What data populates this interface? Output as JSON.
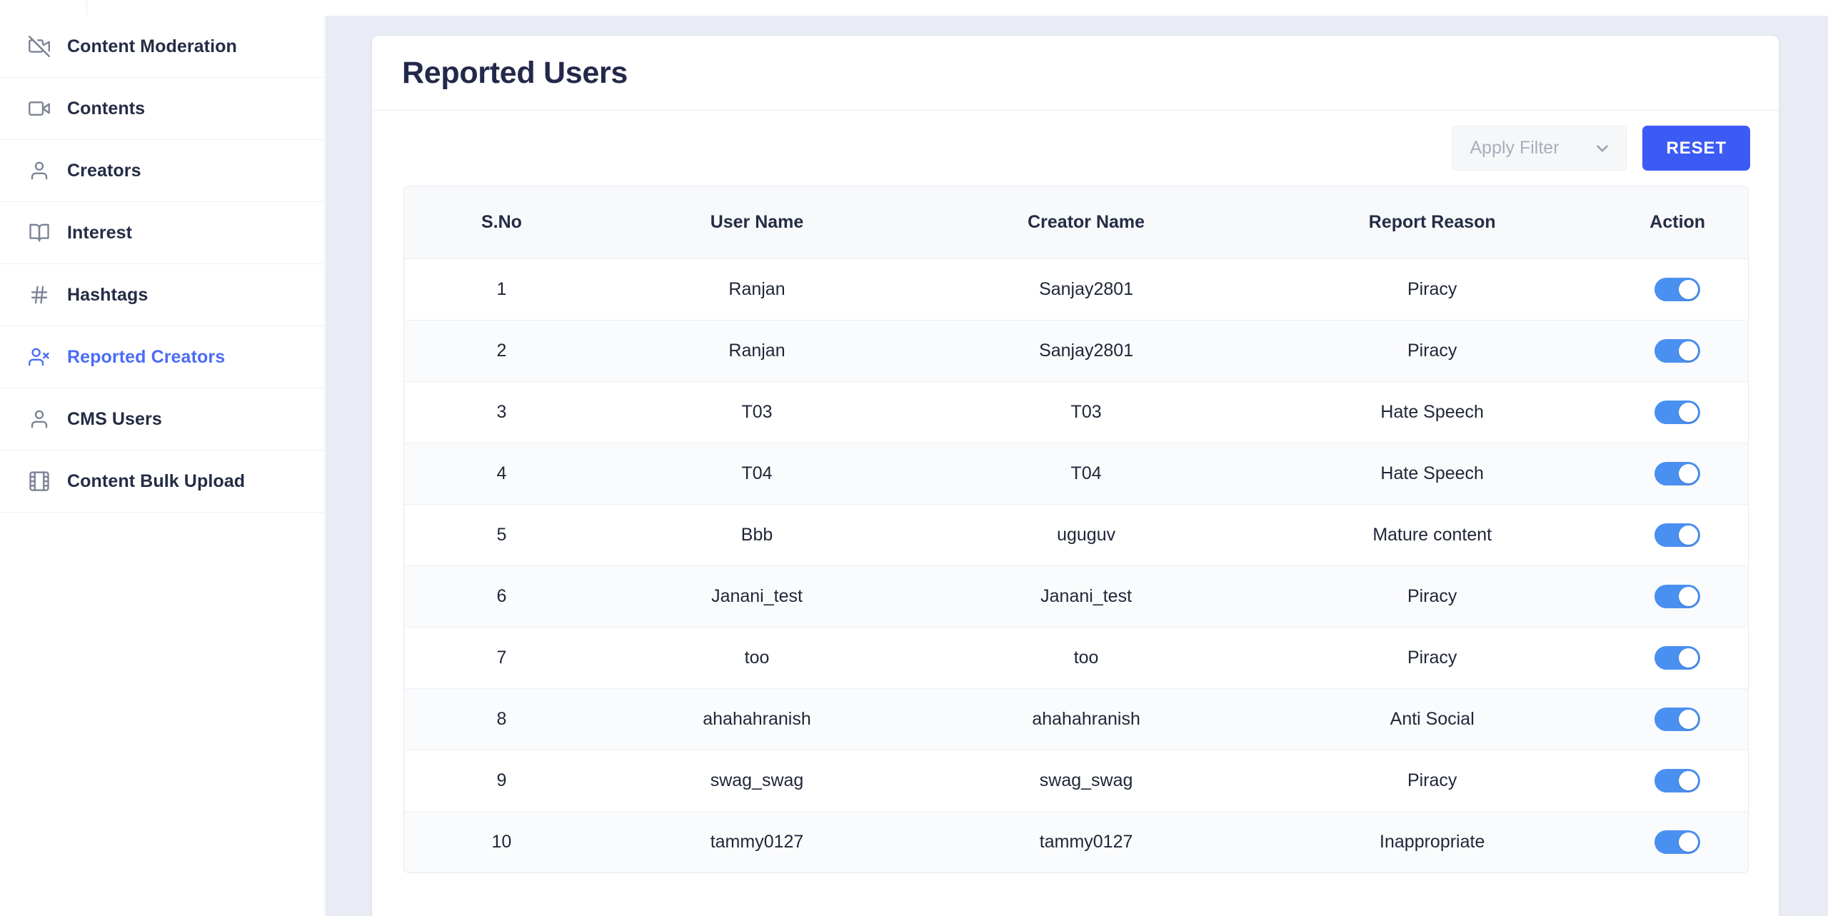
{
  "sidebar": {
    "items": [
      {
        "label": "Content Moderation",
        "icon": "video-off-icon",
        "active": false
      },
      {
        "label": "Contents",
        "icon": "video-icon",
        "active": false
      },
      {
        "label": "Creators",
        "icon": "user-icon",
        "active": false
      },
      {
        "label": "Interest",
        "icon": "book-open-icon",
        "active": false
      },
      {
        "label": "Hashtags",
        "icon": "hash-icon",
        "active": false
      },
      {
        "label": "Reported Creators",
        "icon": "user-x-icon",
        "active": true
      },
      {
        "label": "CMS Users",
        "icon": "user-icon",
        "active": false
      },
      {
        "label": "Content Bulk Upload",
        "icon": "film-icon",
        "active": false
      }
    ],
    "active_color": "#4a6cf7"
  },
  "header": {
    "title": "Reported Users"
  },
  "toolbar": {
    "filter_placeholder": "Apply Filter",
    "filter_value": "",
    "reset_label": "RESET",
    "reset_color": "#3c5bf5"
  },
  "table": {
    "columns": [
      "S.No",
      "User Name",
      "Creator Name",
      "Report Reason",
      "Action"
    ],
    "rows": [
      {
        "sno": "1",
        "user": "Ranjan",
        "creator": "Sanjay2801",
        "reason": "Piracy",
        "toggle": true
      },
      {
        "sno": "2",
        "user": "Ranjan",
        "creator": "Sanjay2801",
        "reason": "Piracy",
        "toggle": true
      },
      {
        "sno": "3",
        "user": "T03",
        "creator": "T03",
        "reason": "Hate Speech",
        "toggle": true
      },
      {
        "sno": "4",
        "user": "T04",
        "creator": "T04",
        "reason": "Hate Speech",
        "toggle": true
      },
      {
        "sno": "5",
        "user": "Bbb",
        "creator": "uguguv",
        "reason": "Mature content",
        "toggle": true
      },
      {
        "sno": "6",
        "user": "Janani_test",
        "creator": "Janani_test",
        "reason": "Piracy",
        "toggle": true
      },
      {
        "sno": "7",
        "user": "too",
        "creator": "too",
        "reason": "Piracy",
        "toggle": true
      },
      {
        "sno": "8",
        "user": "ahahahranish",
        "creator": "ahahahranish",
        "reason": "Anti Social",
        "toggle": true
      },
      {
        "sno": "9",
        "user": "swag_swag",
        "creator": "swag_swag",
        "reason": "Piracy",
        "toggle": true
      },
      {
        "sno": "10",
        "user": "tammy0127",
        "creator": "tammy0127",
        "reason": "Inappropriate",
        "toggle": true
      }
    ]
  }
}
